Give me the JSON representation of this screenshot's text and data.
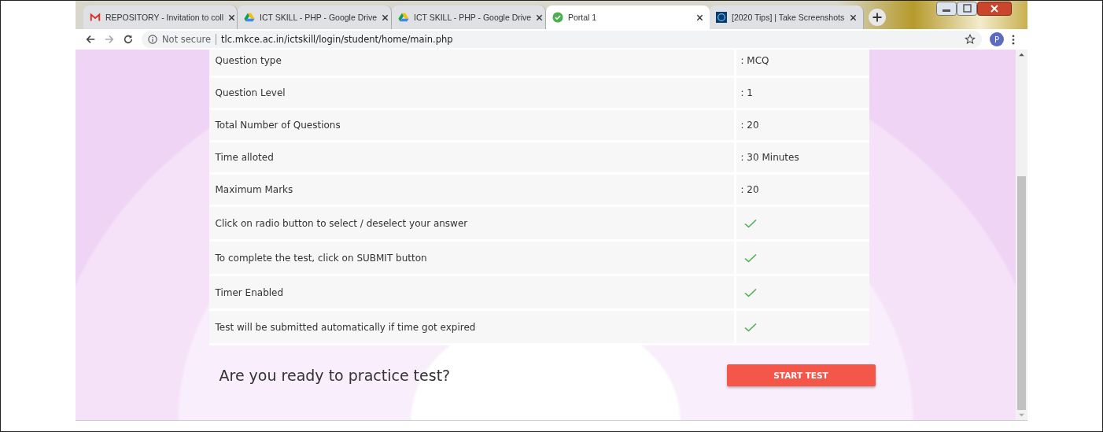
{
  "tabs": [
    {
      "kind": "mail",
      "title": "REPOSITORY - Invitation to coll",
      "selected": false
    },
    {
      "kind": "drive",
      "title": "ICT SKILL - PHP - Google Drive",
      "selected": false
    },
    {
      "kind": "drive",
      "title": "ICT SKILL - PHP - Google Drive",
      "selected": false
    },
    {
      "kind": "check",
      "title": "Portal 1",
      "selected": true
    },
    {
      "kind": "site",
      "title": "[2020 Tips] | Take Screenshots",
      "selected": false
    }
  ],
  "address_bar": {
    "security": "Not secure",
    "url": "tlc.mkce.ac.in/ictskill/login/student/home/main.php",
    "profile": "P"
  },
  "table": {
    "rows": [
      {
        "label": "Question type",
        "kind": "text",
        "value": ": MCQ"
      },
      {
        "label": "Question Level",
        "kind": "text",
        "value": ": 1"
      },
      {
        "label": "Total Number of Questions",
        "kind": "text",
        "value": ": 20"
      },
      {
        "label": "Time alloted",
        "kind": "text",
        "value": ": 30 Minutes"
      },
      {
        "label": "Maximum Marks",
        "kind": "text",
        "value": ": 20"
      },
      {
        "label": "Click on radio button to select / deselect your answer",
        "kind": "check",
        "checked": true
      },
      {
        "label": "To complete the test, click on SUBMIT button",
        "kind": "check",
        "checked": true
      },
      {
        "label": "Timer Enabled",
        "kind": "check",
        "checked": true
      },
      {
        "label": "Test will be submitted automatically if time got expired",
        "kind": "check",
        "checked": true
      }
    ]
  },
  "prompt": "Are you ready to practice test?",
  "start_button": "START TEST"
}
